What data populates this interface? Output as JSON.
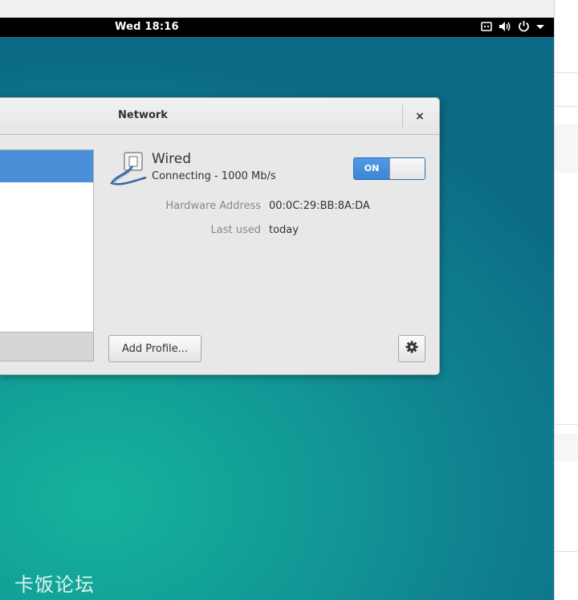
{
  "topbar": {
    "clock": "Wed 18:16",
    "tray_icons": [
      "network-icon",
      "volume-icon",
      "power-icon",
      "dropdown-arrow-icon"
    ]
  },
  "dialog": {
    "title": "Network",
    "close_label": "×",
    "device": {
      "name": "Wired",
      "status": "Connecting - 1000 Mb/s",
      "switch_label": "ON",
      "switch_on": true
    },
    "details": [
      {
        "label": "Hardware Address",
        "value": "00:0C:29:BB:8A:DA"
      },
      {
        "label": "Last used",
        "value": "today"
      }
    ],
    "add_profile_label": "Add Profile...",
    "settings_icon": "gear-icon"
  },
  "watermark": "卡饭论坛",
  "colors": {
    "accent": "#4a90d9",
    "topbar": "#000000",
    "desktop": "#129b97"
  }
}
